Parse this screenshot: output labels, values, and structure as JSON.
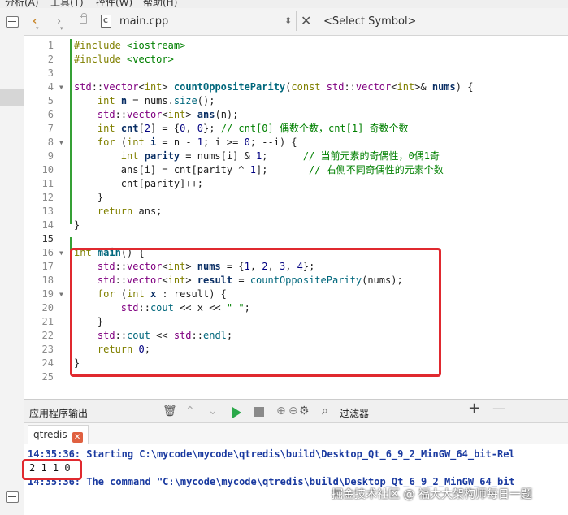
{
  "menubar": {
    "items": [
      "分析(A)",
      "工具(T)",
      "控件(W)",
      "帮助(H)"
    ]
  },
  "toolbar": {
    "file_name": "main.cpp",
    "symbol_placeholder": "<Select Symbol>",
    "back_icon": "chevron-left-icon",
    "forward_icon": "chevron-right-icon",
    "lock_icon": "lock-icon",
    "close_icon": "close-icon"
  },
  "editor": {
    "lines": [
      {
        "n": "1",
        "fold": "",
        "html": "<span class='k'>#include</span> <span class='s'>&lt;iostream&gt;</span>"
      },
      {
        "n": "2",
        "fold": "",
        "html": "<span class='k'>#include</span> <span class='s'>&lt;vector&gt;</span>"
      },
      {
        "n": "3",
        "fold": "",
        "html": ""
      },
      {
        "n": "4",
        "fold": "▼",
        "html": "<span class='std'>std</span>::<span class='t'>vector</span>&lt;<span class='k'>int</span>&gt; <span class='fn'>countOppositeParity</span>(<span class='k'>const</span> <span class='std'>std</span>::<span class='t'>vector</span>&lt;<span class='k'>int</span>&gt;&amp; <span class='v'>nums</span>) {"
      },
      {
        "n": "5",
        "fold": "",
        "html": "    <span class='k'>int</span> <span class='v'>n</span> = nums.<span class='f'>size</span>();"
      },
      {
        "n": "6",
        "fold": "",
        "html": "    <span class='std'>std</span>::<span class='t'>vector</span>&lt;<span class='k'>int</span>&gt; <span class='v'>ans</span>(n);"
      },
      {
        "n": "7",
        "fold": "",
        "html": "    <span class='k'>int</span> <span class='v'>cnt</span>[<span class='n'>2</span>] = {<span class='n'>0</span>, <span class='n'>0</span>}; <span class='c'>// cnt[0] 偶数个数，cnt[1] 奇数个数</span>"
      },
      {
        "n": "8",
        "fold": "▼",
        "html": "    <span class='k'>for</span> (<span class='k'>int</span> <span class='v'>i</span> = n - <span class='n'>1</span>; i &gt;= <span class='n'>0</span>; --i) {"
      },
      {
        "n": "9",
        "fold": "",
        "html": "        <span class='k'>int</span> <span class='v'>parity</span> = nums[i] &amp; <span class='n'>1</span>;      <span class='c'>// 当前元素的奇偶性，0偶1奇</span>"
      },
      {
        "n": "10",
        "fold": "",
        "html": "        ans[i] = cnt[parity ^ <span class='n'>1</span>];       <span class='c'>// 右侧不同奇偶性的元素个数</span>"
      },
      {
        "n": "11",
        "fold": "",
        "html": "        cnt[parity]++;"
      },
      {
        "n": "12",
        "fold": "",
        "html": "    }"
      },
      {
        "n": "13",
        "fold": "",
        "html": "    <span class='k'>return</span> ans;"
      },
      {
        "n": "14",
        "fold": "",
        "html": "}"
      },
      {
        "n": "15",
        "fold": "",
        "html": ""
      },
      {
        "n": "16",
        "fold": "▼",
        "html": "<span class='k'>int</span> <span class='fn'>main</span>() {"
      },
      {
        "n": "17",
        "fold": "",
        "html": "    <span class='std'>std</span>::<span class='t'>vector</span>&lt;<span class='k'>int</span>&gt; <span class='v'>nums</span> = {<span class='n'>1</span>, <span class='n'>2</span>, <span class='n'>3</span>, <span class='n'>4</span>};"
      },
      {
        "n": "18",
        "fold": "",
        "html": "    <span class='std'>std</span>::<span class='t'>vector</span>&lt;<span class='k'>int</span>&gt; <span class='v'>result</span> = <span class='f'>countOppositeParity</span>(nums);"
      },
      {
        "n": "19",
        "fold": "▼",
        "html": "    <span class='k'>for</span> (<span class='k'>int</span> <span class='v'>x</span> : result) {"
      },
      {
        "n": "20",
        "fold": "",
        "html": "        <span class='std'>std</span>::<span class='f'>cout</span> &lt;&lt; x &lt;&lt; <span class='s'>\" \"</span>;"
      },
      {
        "n": "21",
        "fold": "",
        "html": "    }"
      },
      {
        "n": "22",
        "fold": "",
        "html": "    <span class='std'>std</span>::<span class='f'>cout</span> &lt;&lt; <span class='std'>std</span>::<span class='f'>endl</span>;"
      },
      {
        "n": "23",
        "fold": "",
        "html": "    <span class='k'>return</span> <span class='n'>0</span>;"
      },
      {
        "n": "24",
        "fold": "",
        "html": "}"
      },
      {
        "n": "25",
        "fold": "",
        "html": ""
      }
    ],
    "current_line": "15"
  },
  "output_panel": {
    "title": "应用程序输出",
    "filter_label": "过滤器",
    "tab_label": "qtredis",
    "lines": [
      {
        "text": "14:35:36: Starting C:\\mycode\\mycode\\qtredis\\build\\Desktop_Qt_6_9_2_MinGW_64_bit-Rel",
        "style": "blue"
      },
      {
        "text": "2 1 1 0",
        "style": "plain"
      },
      {
        "text": "14:35:36: The command \"C:\\mycode\\mycode\\qtredis\\build\\Desktop_Qt_6_9_2_MinGW_64_bit",
        "style": "blue"
      }
    ]
  },
  "watermark": "掘金技术社区 @ 福大大架构师每日一题",
  "colors": {
    "highlight_border": "#e0292f",
    "run_green": "#2ba84a",
    "output_blue": "#1a3aa0"
  }
}
